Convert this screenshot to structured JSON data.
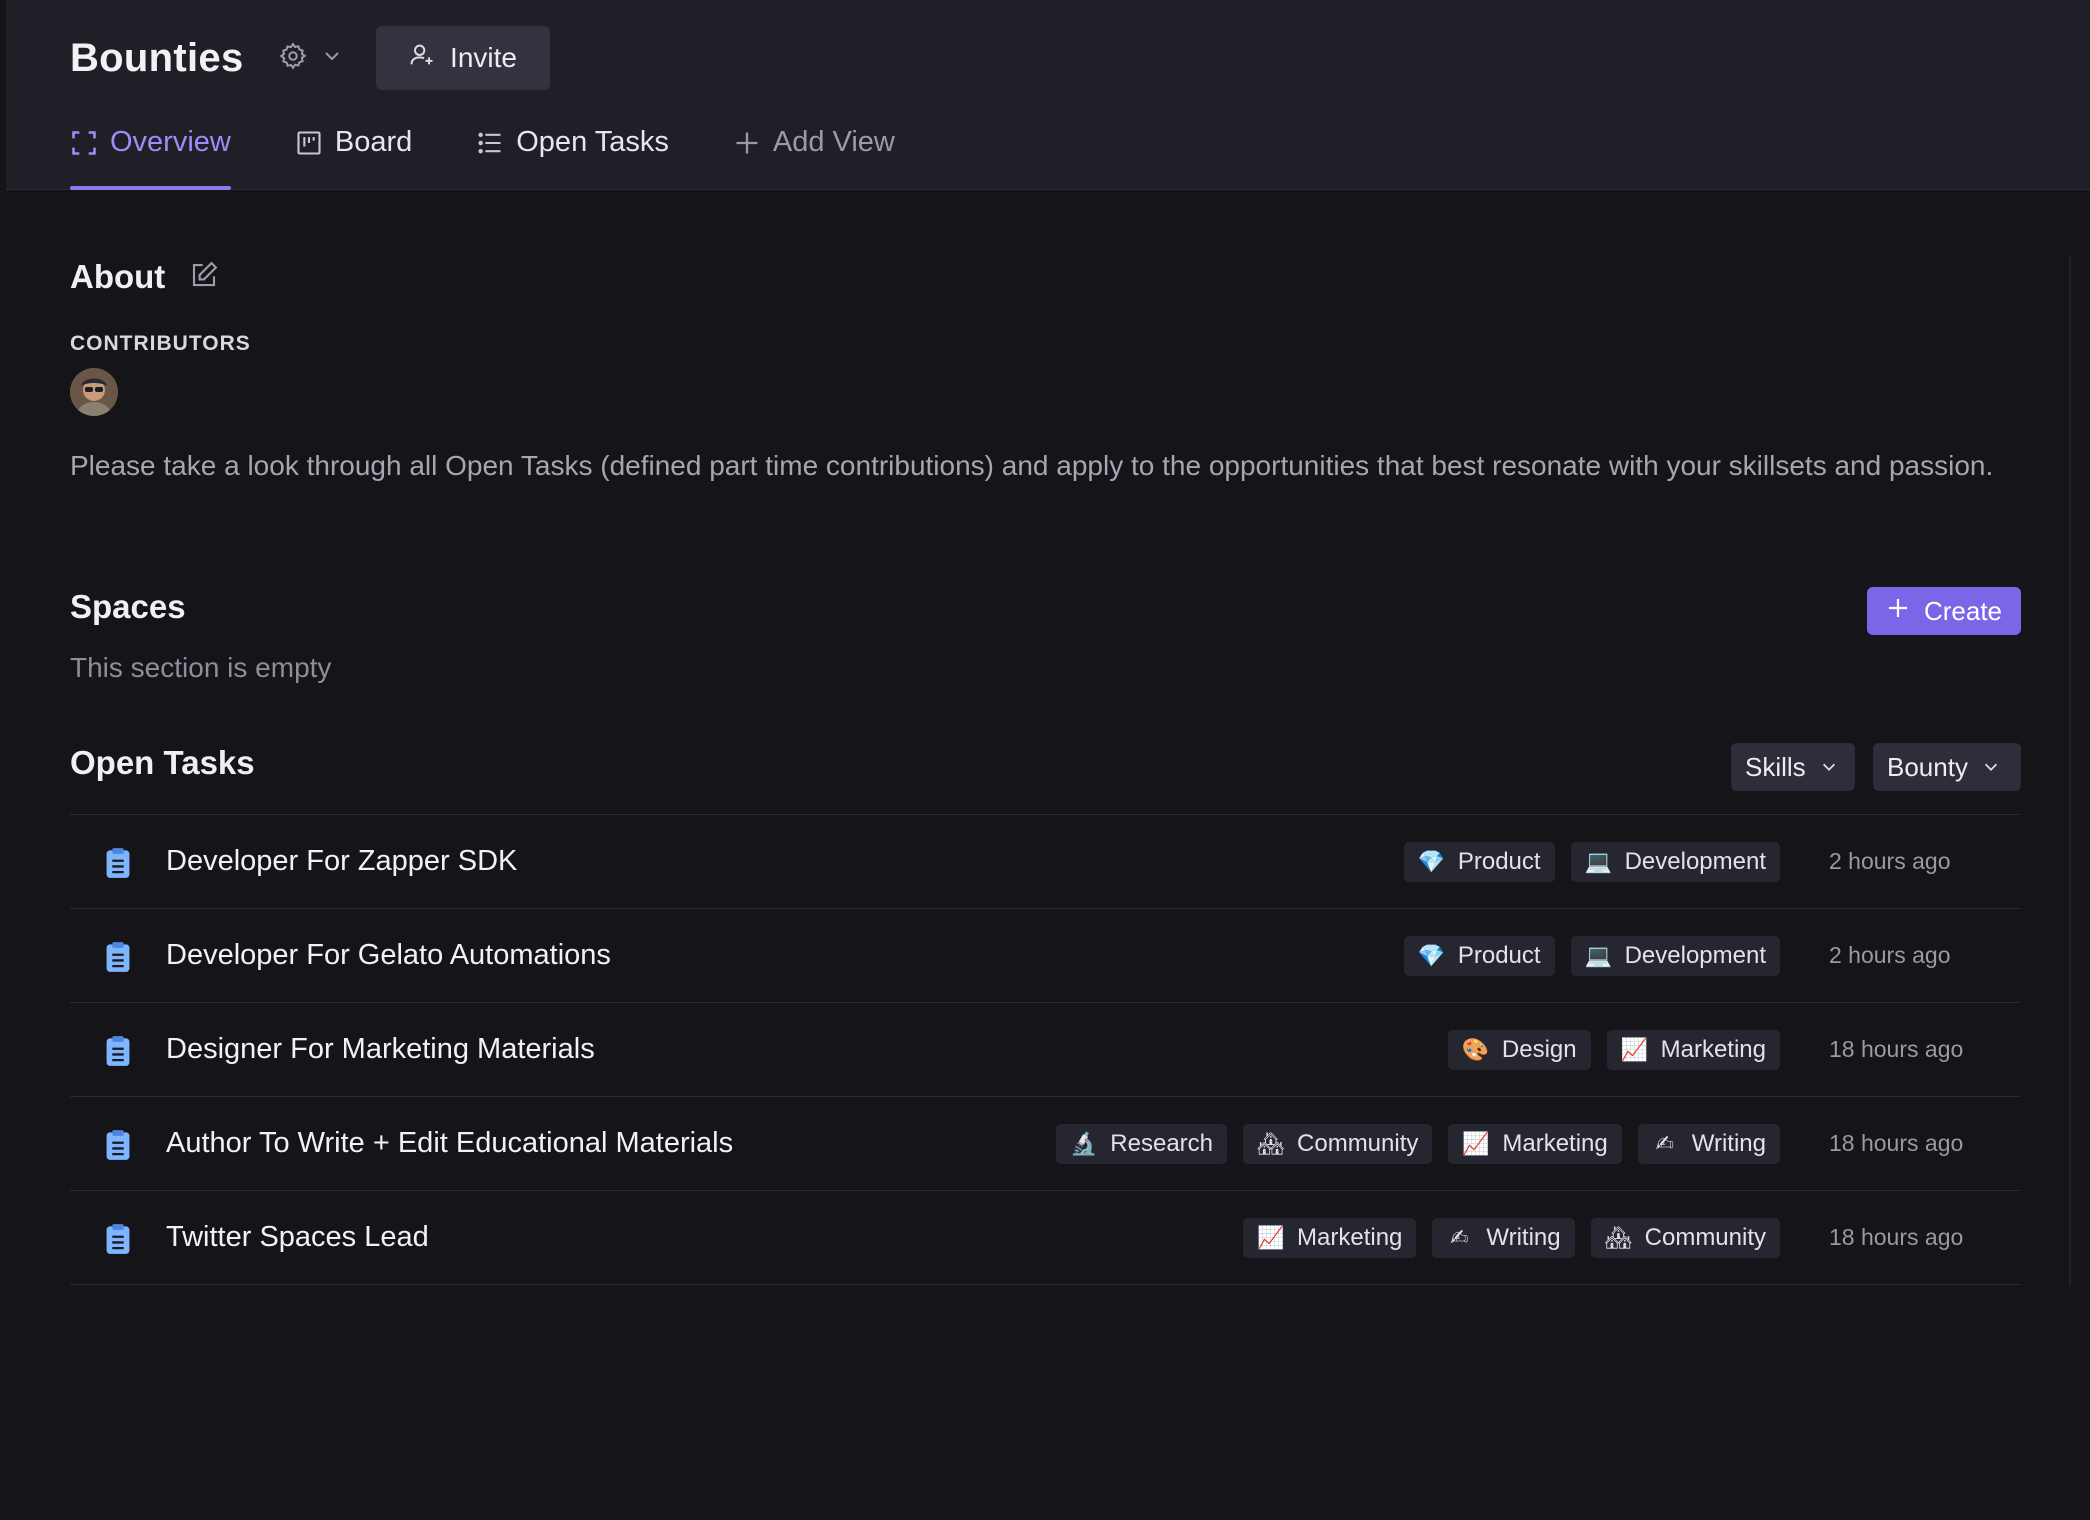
{
  "header": {
    "title": "Bounties",
    "invite_label": "Invite"
  },
  "tabs": [
    {
      "label": "Overview",
      "active": true,
      "icon": "overview-icon"
    },
    {
      "label": "Board",
      "icon": "board-icon"
    },
    {
      "label": "Open Tasks",
      "icon": "list-icon"
    },
    {
      "label": "Add View",
      "icon": "plus-icon"
    }
  ],
  "about": {
    "title": "About",
    "contributors_label": "CONTRIBUTORS",
    "description": "Please take a look through all Open Tasks (defined part time contributions) and apply to the opportunities that best resonate with your skillsets and passion."
  },
  "spaces": {
    "title": "Spaces",
    "create_label": "Create",
    "empty_text": "This section is empty"
  },
  "open_tasks": {
    "title": "Open Tasks",
    "filters": [
      {
        "label": "Skills"
      },
      {
        "label": "Bounty"
      }
    ],
    "rows": [
      {
        "name": "Developer For Zapper SDK",
        "tags": [
          {
            "emoji": "💎",
            "label": "Product"
          },
          {
            "emoji": "💻",
            "label": "Development"
          }
        ],
        "time": "2 hours ago"
      },
      {
        "name": "Developer For Gelato Automations",
        "tags": [
          {
            "emoji": "💎",
            "label": "Product"
          },
          {
            "emoji": "💻",
            "label": "Development"
          }
        ],
        "time": "2 hours ago"
      },
      {
        "name": "Designer For Marketing Materials",
        "tags": [
          {
            "emoji": "🎨",
            "label": "Design"
          },
          {
            "emoji": "📈",
            "label": "Marketing"
          }
        ],
        "time": "18 hours ago"
      },
      {
        "name": "Author To Write + Edit Educational Materials",
        "tags": [
          {
            "emoji": "🔬",
            "label": "Research"
          },
          {
            "emoji": "🏘",
            "label": "Community"
          },
          {
            "emoji": "📈",
            "label": "Marketing"
          },
          {
            "emoji": "✍",
            "label": "Writing"
          }
        ],
        "time": "18 hours ago"
      },
      {
        "name": "Twitter Spaces Lead",
        "tags": [
          {
            "emoji": "📈",
            "label": "Marketing"
          },
          {
            "emoji": "✍",
            "label": "Writing"
          },
          {
            "emoji": "🏘",
            "label": "Community"
          }
        ],
        "time": "18 hours ago"
      }
    ]
  },
  "colors": {
    "accent": "#7c66e8",
    "tab_active": "#9f8cf6",
    "task_icon": "#7fb4ff"
  }
}
